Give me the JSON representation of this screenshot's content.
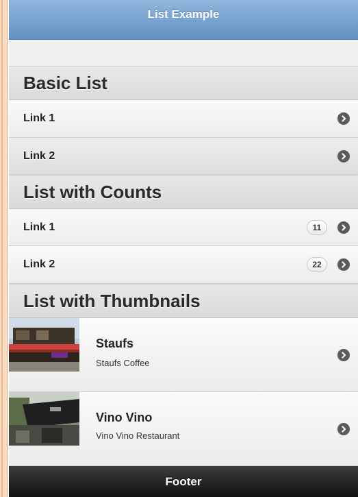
{
  "header": {
    "title": "List Example"
  },
  "basic_list": {
    "heading": "Basic List",
    "items": [
      {
        "label": "Link 1"
      },
      {
        "label": "Link 2"
      }
    ]
  },
  "counts_list": {
    "heading": "List with Counts",
    "items": [
      {
        "label": "Link 1",
        "count": "11"
      },
      {
        "label": "Link 2",
        "count": "22"
      }
    ]
  },
  "thumbnail_list": {
    "heading": "List with Thumbnails",
    "items": [
      {
        "title": "Staufs",
        "subtitle": "Staufs Coffee"
      },
      {
        "title": "Vino Vino",
        "subtitle": "Vino Vino Restaurant"
      }
    ]
  },
  "footer": {
    "title": "Footer"
  },
  "icons": {
    "row_arrow": "arrow-right-circle-icon"
  },
  "colors": {
    "header": "#6f9ccd",
    "footer": "#1c1c1c",
    "arrow": "#5b5b5b",
    "page_edge": "#e3a36d"
  }
}
